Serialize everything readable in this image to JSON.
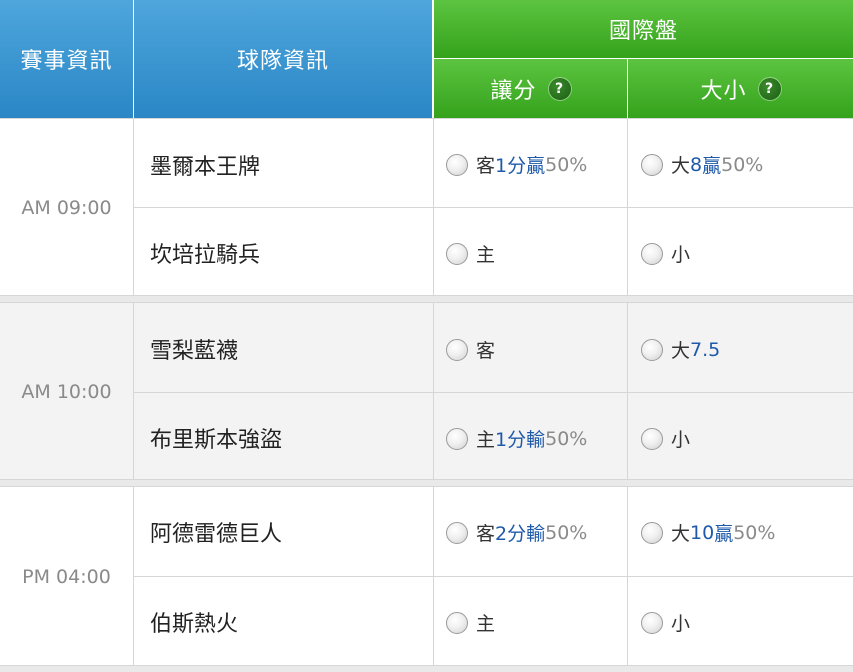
{
  "header": {
    "event_info": "賽事資訊",
    "team_info": "球隊資訊",
    "international": "國際盤",
    "spread": "讓分",
    "over_under": "大小",
    "help_mark": "?"
  },
  "matches": [
    {
      "time": "AM 09:00",
      "rows": [
        {
          "team": "墨爾本王牌",
          "spread": {
            "a": "客",
            "b": "1分",
            "c": "贏",
            "d": "50%"
          },
          "total": {
            "a": "大",
            "b": "8",
            "c": "贏",
            "d": "50%"
          }
        },
        {
          "team": "坎培拉騎兵",
          "spread": {
            "a": "主",
            "b": "",
            "c": "",
            "d": ""
          },
          "total": {
            "a": "小",
            "b": "",
            "c": "",
            "d": ""
          }
        }
      ]
    },
    {
      "time": "AM 10:00",
      "rows": [
        {
          "team": "雪梨藍襪",
          "spread": {
            "a": "客",
            "b": "",
            "c": "",
            "d": ""
          },
          "total": {
            "a": "大",
            "b": "7.5",
            "c": "",
            "d": ""
          }
        },
        {
          "team": "布里斯本強盜",
          "spread": {
            "a": "主",
            "b": "1分",
            "c": "輸",
            "d": "50%"
          },
          "total": {
            "a": "小",
            "b": "",
            "c": "",
            "d": ""
          }
        }
      ]
    },
    {
      "time": "PM 04:00",
      "rows": [
        {
          "team": "阿德雷德巨人",
          "spread": {
            "a": "客",
            "b": "2分",
            "c": "輸",
            "d": "50%"
          },
          "total": {
            "a": "大",
            "b": "10",
            "c": "贏",
            "d": "50%"
          }
        },
        {
          "team": "伯斯熱火",
          "spread": {
            "a": "主",
            "b": "",
            "c": "",
            "d": ""
          },
          "total": {
            "a": "小",
            "b": "",
            "c": "",
            "d": ""
          }
        }
      ]
    }
  ]
}
